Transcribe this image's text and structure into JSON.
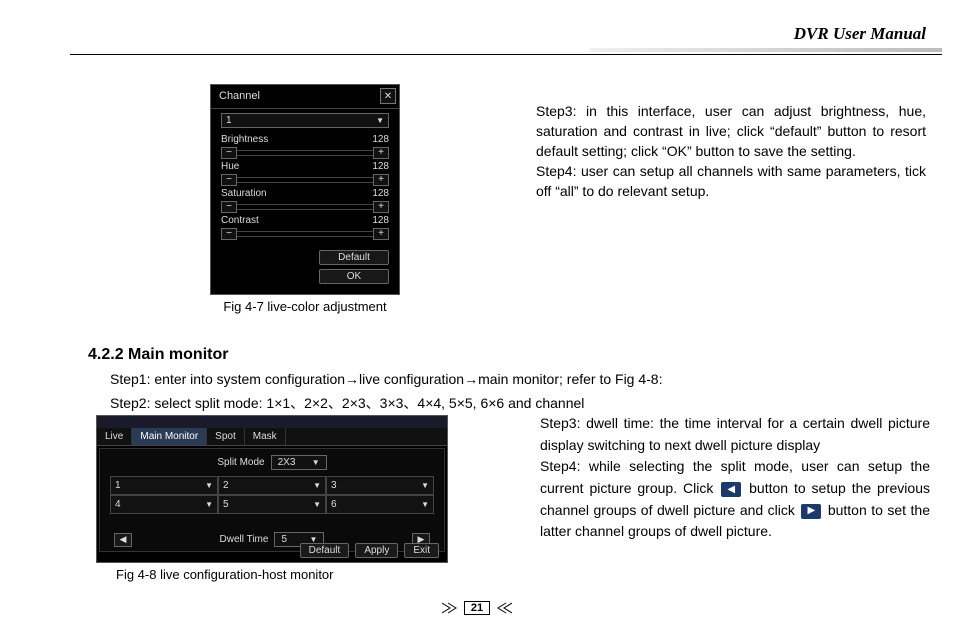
{
  "header": {
    "title": "DVR User Manual"
  },
  "fig47": {
    "titlebar_label": "Channel",
    "channel_value": "1",
    "params": [
      {
        "label": "Brightness",
        "value": "128"
      },
      {
        "label": "Hue",
        "value": "128"
      },
      {
        "label": "Saturation",
        "value": "128"
      },
      {
        "label": "Contrast",
        "value": "128"
      }
    ],
    "default_btn": "Default",
    "ok_btn": "OK",
    "caption": "Fig 4-7 live-color adjustment"
  },
  "right1": {
    "step3": "Step3: in this interface, user can adjust brightness, hue, saturation and contrast in live; click “default” button to resort default setting; click “OK” button to save the setting.",
    "step4": "Step4: user can setup all channels with same parameters, tick off “all” to do relevant setup."
  },
  "section": {
    "heading": "4.2.2  Main monitor",
    "step1": "Step1: enter into system configuration→live configuration→main monitor; refer to Fig 4-8:",
    "step2": "Step2: select split mode: 1×1、2×2、2×3、3×3、4×4, 5×5, 6×6 and channel"
  },
  "fig48": {
    "tabs": [
      "Live",
      "Main Monitor",
      "Spot",
      "Mask"
    ],
    "split_label": "Split Mode",
    "split_value": "2X3",
    "channels": [
      "1",
      "2",
      "3",
      "4",
      "5",
      "6"
    ],
    "dwell_label": "Dwell Time",
    "dwell_value": "5",
    "buttons": {
      "default": "Default",
      "apply": "Apply",
      "exit": "Exit"
    },
    "caption": "Fig 4-8 live configuration-host monitor"
  },
  "right2": {
    "step3": "Step3: dwell time: the time interval for a certain dwell picture display switching to next dwell picture display",
    "step4a": "Step4: while selecting the split mode, user can setup the current picture group. Click ",
    "step4b": " button to setup the previous channel groups of dwell picture and click ",
    "step4c": " button to set the latter channel groups of dwell picture."
  },
  "page_number": "21"
}
